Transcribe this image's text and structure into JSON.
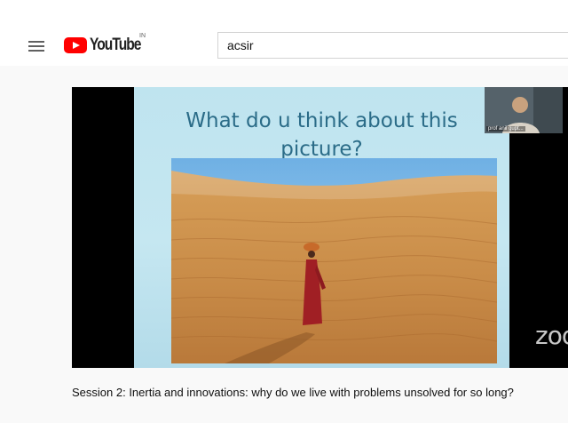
{
  "header": {
    "logo_text": "YouTube",
    "country_code": "IN",
    "search_value": "acsir"
  },
  "video": {
    "slide_title_line1": "What do u think about this",
    "slide_title_line2": "picture?",
    "webcam_name": "prof anil gupt...",
    "watermark": "zoom",
    "title": "Session 2: Inertia and innovations: why do we live with problems unsolved for so long?"
  }
}
